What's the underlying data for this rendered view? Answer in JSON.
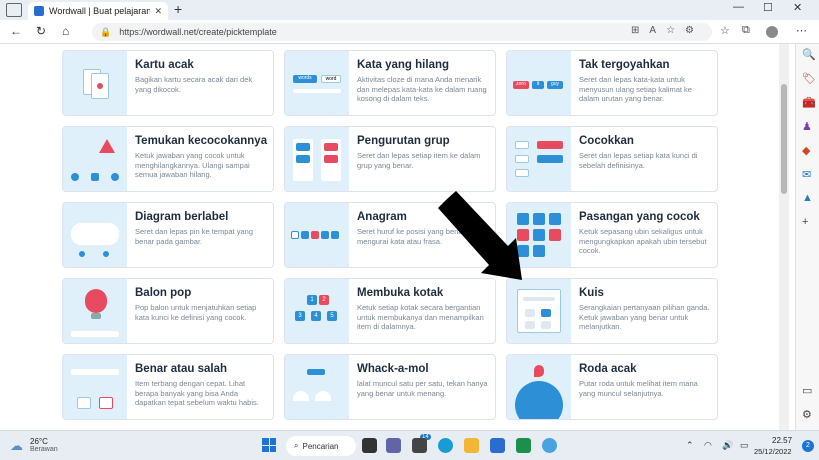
{
  "browser": {
    "tab_title": "Wordwall | Buat pelajaran yang le",
    "tab_close": "✕",
    "new_tab": "+",
    "url": "https://wordwall.net/create/picktemplate",
    "win_min": "—",
    "win_max": "☐",
    "win_close": "✕"
  },
  "templates": [
    {
      "title": "Kartu acak",
      "desc": "Bagikan kartu secara acak dari dek yang dikocok."
    },
    {
      "title": "Kata yang hilang",
      "desc": "Aktivitas cloze di mana Anda menarik dan melepas kata-kata ke dalam ruang kosong di dalam teks."
    },
    {
      "title": "Tak tergoyahkan",
      "desc": "Seret dan lepas kata-kata untuk menyusun ulang setiap kalimat ke dalam urutan yang benar."
    },
    {
      "title": "Temukan kecocokannya",
      "desc": "Ketuk jawaban yang cocok untuk menghilangkannya. Ulangi sampai semua jawaban hilang."
    },
    {
      "title": "Pengurutan grup",
      "desc": "Seret dan lepas setiap item ke dalam grup yang benar."
    },
    {
      "title": "Cocokkan",
      "desc": "Seret dan lepas setiap kata kunci di sebelah definisinya."
    },
    {
      "title": "Diagram berlabel",
      "desc": "Seret dan lepas pin ke tempat yang benar pada gambar."
    },
    {
      "title": "Anagram",
      "desc": "Seret huruf ke posisi yang benar untuk mengurai kata atau frasa."
    },
    {
      "title": "Pasangan yang cocok",
      "desc": "Ketuk sepasang ubin sekaligus untuk mengungkapkan apakah ubin tersebut cocok."
    },
    {
      "title": "Balon pop",
      "desc": "Pop balon untuk menjatuhkan setiap kata kunci ke definisi yang cocok."
    },
    {
      "title": "Membuka kotak",
      "desc": "Ketuk setiap kotak secara bergantian untuk membukanya dan menampilkan item di dalamnya."
    },
    {
      "title": "Kuis",
      "desc": "Serangkaian pertanyaan pilihan ganda. Ketuk jawaban yang benar untuk melanjutkan."
    },
    {
      "title": "Benar atau salah",
      "desc": "Item terbang dengan cepat. Lihat berapa banyak yang bisa Anda dapatkan tepat sebelum waktu habis."
    },
    {
      "title": "Whack-a-mol",
      "desc": "lalat muncul satu per satu, tekan hanya yang benar untuk menang."
    },
    {
      "title": "Roda acak",
      "desc": "Putar roda untuk melihat item mana yang muncul selanjutnya."
    }
  ],
  "thumb_text": {
    "missing_1": "words",
    "missing_2": "word",
    "unjumble_1": "zero",
    "unjumble_2": "it",
    "unjumble_3": "guy",
    "open_1": "1",
    "open_2": "2",
    "open_3": "3",
    "open_4": "4",
    "open_5": "5"
  },
  "taskbar": {
    "temp": "26°C",
    "weather": "Berawan",
    "search": "Pencarian",
    "time": "22.57",
    "date": "25/12/2022",
    "notifications": "2",
    "chat_badge": "14"
  },
  "colors": {
    "accent": "#1b74d6",
    "thumb_bg": "#dff0fb",
    "red": "#e84a5f",
    "blue": "#2d8fd5"
  }
}
